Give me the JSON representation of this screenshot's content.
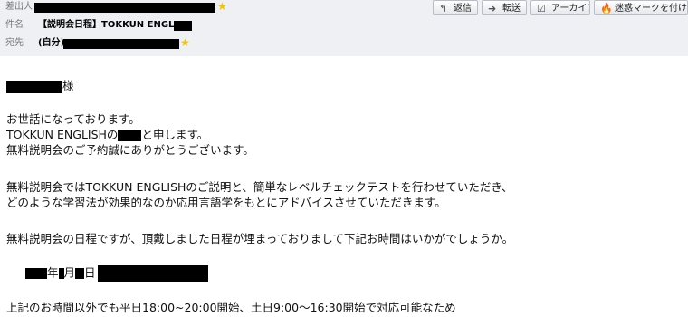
{
  "header": {
    "from_label": "差出人",
    "subject_label": "件名",
    "subject_value": "【説明会日程】TOKKUN ENGLISH",
    "to_label": "宛先",
    "to_value": "(自分)"
  },
  "toolbar": {
    "reply_label": "返信",
    "forward_label": "転送",
    "archive_label": "アーカイブ",
    "junk_label": "迷惑マークを付ける"
  },
  "message": {
    "salutation_suffix": "様",
    "line1": "お世話になっております。",
    "line2_prefix": "TOKKUN ENGLISHの",
    "line2_suffix": "と申します。",
    "line3": "無料説明会のご予約誠にありがとうございます。",
    "line4": "無料説明会ではTOKKUN ENGLISHのご説明と、簡単なレベルチェックテストを行わせていただき、",
    "line5": "どのような学習法が効果的なのか応用言語学をもとにアドバイスさせていただきます。",
    "line6": "無料説明会の日程ですが、頂戴しました日程が埋まっておりまして下記お時間はいかがでしょうか。",
    "date_year": "年",
    "date_month": "月",
    "date_day": "日",
    "line7": "上記のお時間以外でも平日18:00~20:00開始、土日9:00～16:30開始で対応可能なため"
  }
}
